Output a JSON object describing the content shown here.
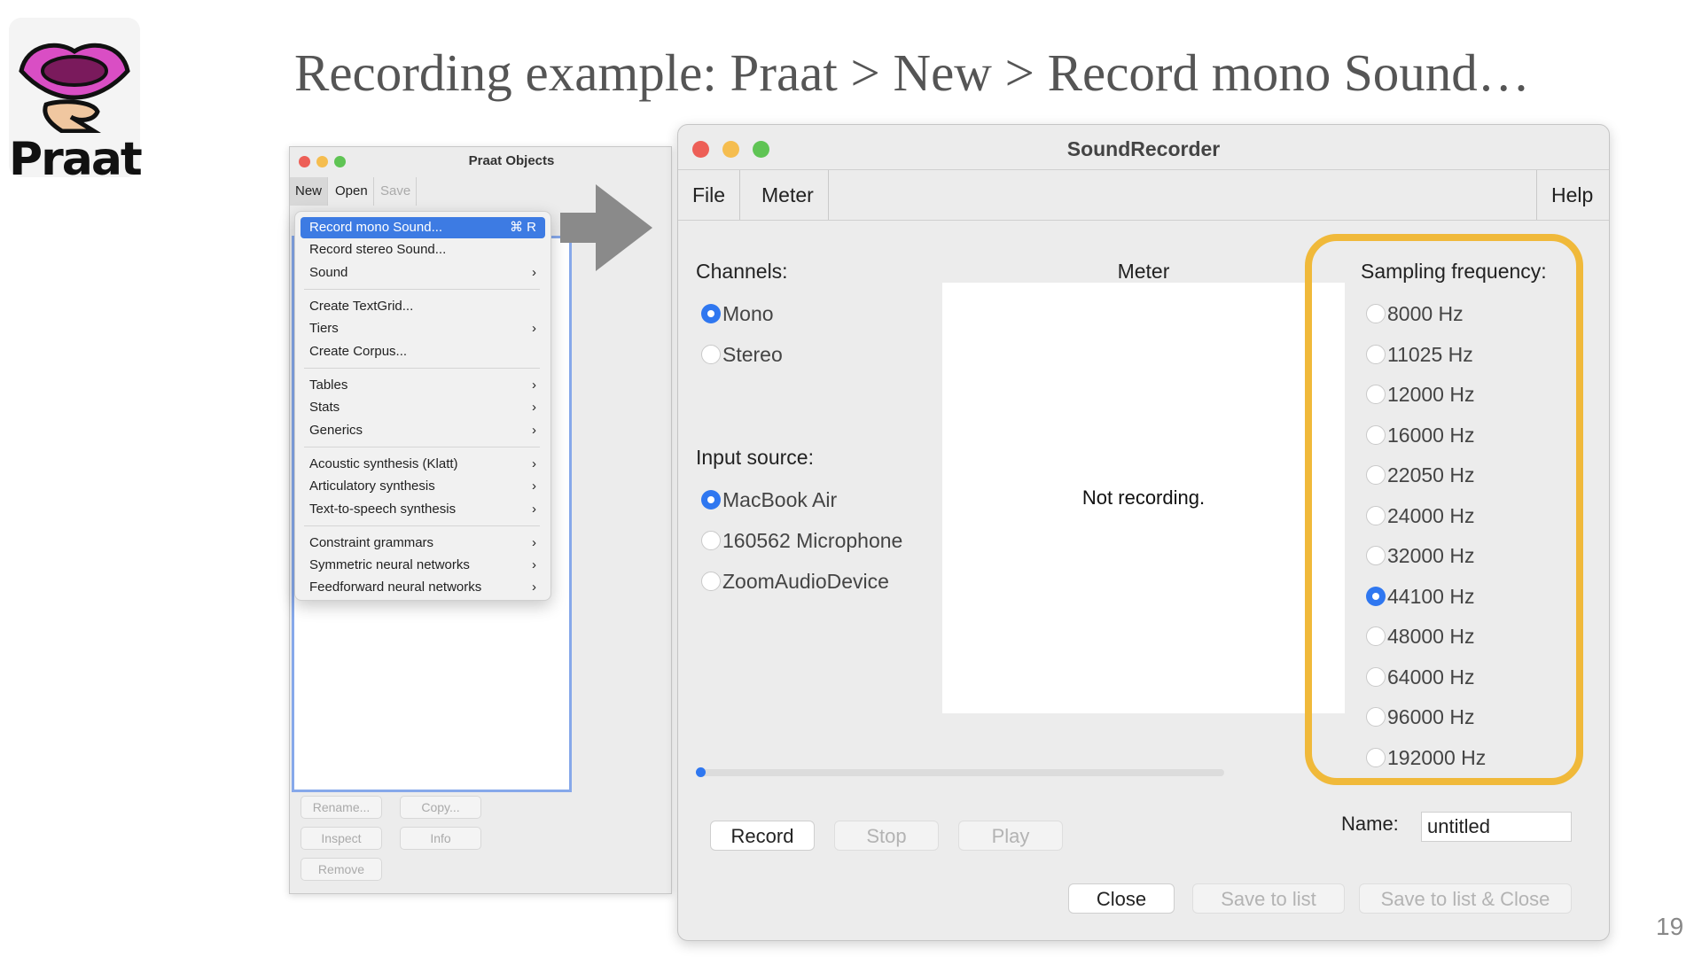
{
  "slide": {
    "title": "Recording example: Praat > New > Record mono Sound…",
    "page_number": "19",
    "logo_text": "Praat"
  },
  "objects_window": {
    "title": "Praat Objects",
    "menus": [
      "New",
      "Open",
      "Save"
    ],
    "buttons": [
      "Rename...",
      "Copy...",
      "Inspect",
      "Info",
      "Remove"
    ]
  },
  "new_menu": {
    "items": [
      {
        "label": "Record mono Sound...",
        "shortcut": "⌘ R",
        "selected": true
      },
      {
        "label": "Record stereo Sound..."
      },
      {
        "label": "Sound",
        "submenu": true
      },
      {
        "label": "Create TextGrid..."
      },
      {
        "label": "Tiers",
        "submenu": true
      },
      {
        "label": "Create Corpus..."
      },
      {
        "label": "Tables",
        "submenu": true
      },
      {
        "label": "Stats",
        "submenu": true
      },
      {
        "label": "Generics",
        "submenu": true
      },
      {
        "label": "Acoustic synthesis (Klatt)",
        "submenu": true
      },
      {
        "label": "Articulatory synthesis",
        "submenu": true
      },
      {
        "label": "Text-to-speech synthesis",
        "submenu": true
      },
      {
        "label": "Constraint grammars",
        "submenu": true
      },
      {
        "label": "Symmetric neural networks",
        "submenu": true
      },
      {
        "label": "Feedforward neural networks",
        "submenu": true
      }
    ],
    "submenu_arrow": "›"
  },
  "recorder": {
    "title": "SoundRecorder",
    "menus": {
      "file": "File",
      "meter": "Meter",
      "help": "Help"
    },
    "channels": {
      "label": "Channels:",
      "options": [
        "Mono",
        "Stereo"
      ],
      "selected": "Mono"
    },
    "input_source": {
      "label": "Input source:",
      "options": [
        "MacBook Air",
        "160562 Microphone",
        "ZoomAudioDevice"
      ],
      "selected": "MacBook Air"
    },
    "meter": {
      "label": "Meter",
      "status": "Not recording."
    },
    "sampling": {
      "label": "Sampling frequency:",
      "options": [
        "8000 Hz",
        "11025 Hz",
        "12000 Hz",
        "16000 Hz",
        "22050 Hz",
        "24000 Hz",
        "32000 Hz",
        "44100 Hz",
        "48000 Hz",
        "64000 Hz",
        "96000 Hz",
        "192000 Hz"
      ],
      "selected": "44100 Hz"
    },
    "progress": 0,
    "buttons": {
      "record": "Record",
      "stop": "Stop",
      "play": "Play",
      "close": "Close",
      "save_to_list": "Save to list",
      "save_to_list_close": "Save to list & Close"
    },
    "name": {
      "label": "Name:",
      "value": "untitled"
    }
  },
  "colors": {
    "highlight": "#f0b93a",
    "selection": "#3d7be3",
    "traffic_red": "#ed5f57",
    "traffic_yellow": "#f5bd4f",
    "traffic_green": "#5fc454"
  }
}
